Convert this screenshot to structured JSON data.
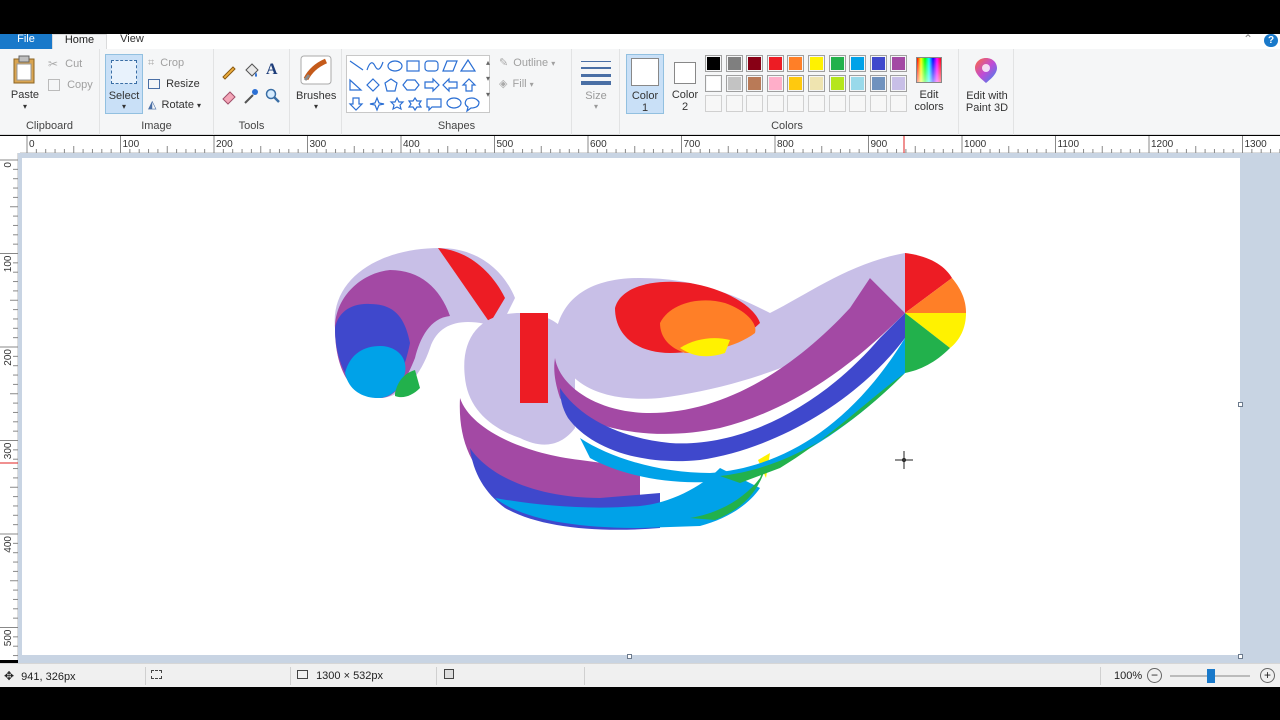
{
  "menu": {
    "file": "File",
    "home": "Home",
    "view": "View"
  },
  "clipboard": {
    "paste": "Paste",
    "cut": "Cut",
    "copy": "Copy",
    "label": "Clipboard"
  },
  "image": {
    "select": "Select",
    "crop": "Crop",
    "resize": "Resize",
    "rotate": "Rotate",
    "label": "Image"
  },
  "tools": {
    "label": "Tools"
  },
  "brushes": {
    "label": "Brushes"
  },
  "shapes": {
    "outline": "Outline",
    "fill": "Fill",
    "label": "Shapes"
  },
  "size": {
    "label": "Size"
  },
  "colors": {
    "color1_label": "Color",
    "color1_num": "1",
    "color2_label": "Color",
    "color2_num": "2",
    "edit_colors_1": "Edit",
    "edit_colors_2": "colors",
    "label": "Colors",
    "palette_row1": [
      "#000000",
      "#7f7f7f",
      "#880015",
      "#ed1c24",
      "#ff7f27",
      "#fff200",
      "#22b14c",
      "#00a2e8",
      "#3f48cc",
      "#a349a4"
    ],
    "palette_row2": [
      "#ffffff",
      "#c3c3c3",
      "#b97a57",
      "#ffaec9",
      "#ffc90e",
      "#efe4b0",
      "#b5e61d",
      "#99d9ea",
      "#7092be",
      "#c8bfe7"
    ]
  },
  "paint3d": {
    "line1": "Edit with",
    "line2": "Paint 3D"
  },
  "ruler": {
    "h_ticks": [
      "0",
      "100",
      "200",
      "300",
      "400",
      "500",
      "600",
      "700",
      "800",
      "900",
      "1000",
      "1100",
      "1200",
      "1300"
    ],
    "v_ticks": [
      "0",
      "100",
      "200",
      "300",
      "400",
      "500"
    ]
  },
  "status": {
    "cursor_pos": "941, 326px",
    "canvas_size": "1300 × 532px",
    "zoom": "100%"
  }
}
